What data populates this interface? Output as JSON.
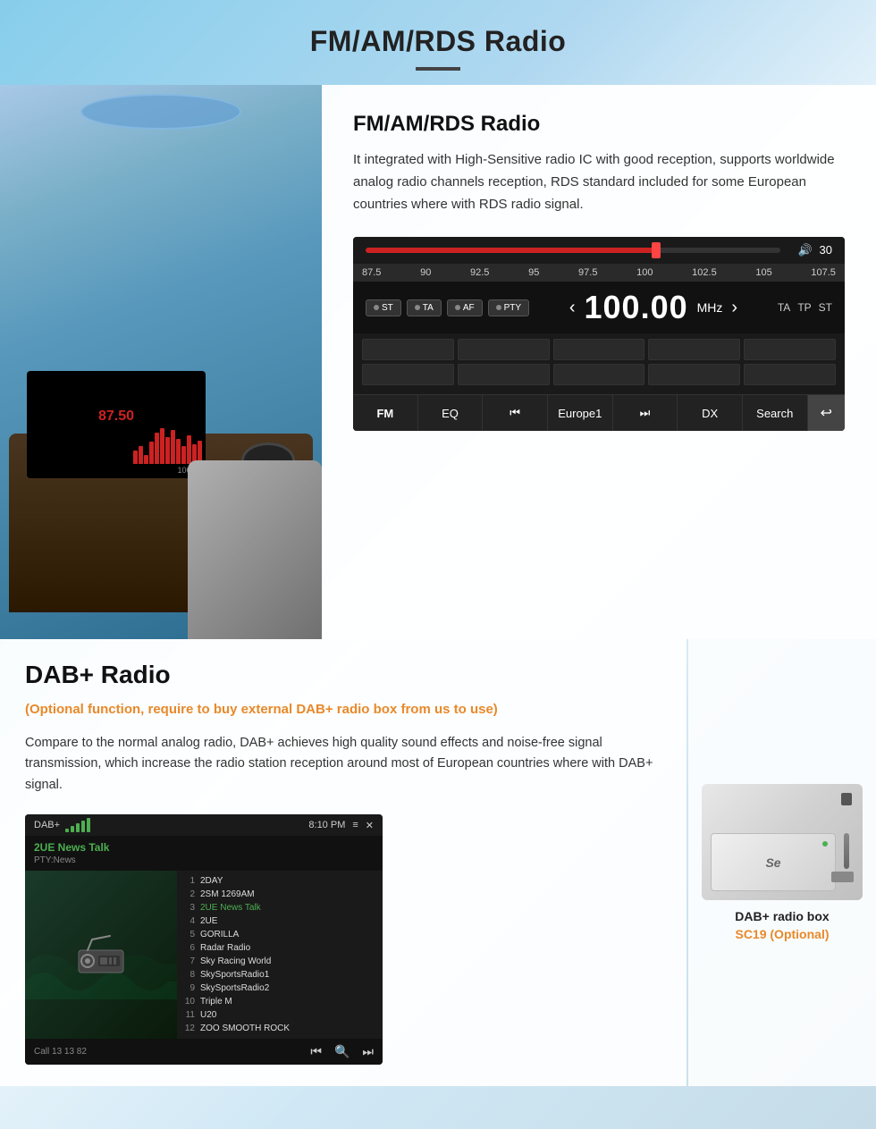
{
  "page": {
    "title": "FM/AM/RDS Radio",
    "title_underline": true
  },
  "fm_section": {
    "title": "FM/AM/RDS Radio",
    "description": "It integrated with High-Sensitive radio IC with good reception, supports worldwide analog radio channels reception, RDS standard included for some European countries where with RDS radio signal.",
    "radio_ui": {
      "volume_label": "30",
      "volume_icon": "🔊",
      "freq_scale": [
        "87.5",
        "90",
        "92.5",
        "95",
        "97.5",
        "100",
        "102.5",
        "105",
        "107.5"
      ],
      "presets": [
        "ST",
        "TA",
        "AF",
        "PTY"
      ],
      "frequency": "100.00",
      "freq_unit": "MHz",
      "right_btns": [
        "TA",
        "TP",
        "ST"
      ],
      "bottom_btns": [
        "FM",
        "EQ",
        "⏮",
        "Europe1",
        "⏭",
        "DX",
        "Search"
      ],
      "back_btn": "↩"
    }
  },
  "dab_section": {
    "title": "DAB+ Radio",
    "optional_text": "(Optional function, require to buy external DAB+ radio box from us to use)",
    "description": "Compare to the normal analog radio, DAB+ achieves high quality sound effects and noise-free signal transmission, which increase the radio station reception around most of European countries where with DAB+ signal.",
    "dab_ui": {
      "label": "DAB+",
      "time": "8:10 PM",
      "station_name": "2UE News Talk",
      "pty": "PTY:News",
      "stations": [
        {
          "num": "1",
          "name": "2DAY"
        },
        {
          "num": "2",
          "name": "2SM 1269AM"
        },
        {
          "num": "3",
          "name": "2UE News Talk"
        },
        {
          "num": "4",
          "name": "2UE"
        },
        {
          "num": "5",
          "name": "GORILLA"
        },
        {
          "num": "6",
          "name": "Radar Radio"
        },
        {
          "num": "7",
          "name": "Sky Racing World"
        },
        {
          "num": "8",
          "name": "SkySportsRadio1"
        },
        {
          "num": "9",
          "name": "SkySportsRadio2"
        },
        {
          "num": "10",
          "name": "Triple M"
        },
        {
          "num": "11",
          "name": "U20"
        },
        {
          "num": "12",
          "name": "ZOO SMOOTH ROCK"
        }
      ],
      "call_label": "Call 13 13 82",
      "controls": [
        "⏮",
        "🔍",
        "⏭"
      ]
    },
    "dab_box": {
      "label": "DAB+ radio box",
      "model": "SC19 (Optional)"
    }
  }
}
